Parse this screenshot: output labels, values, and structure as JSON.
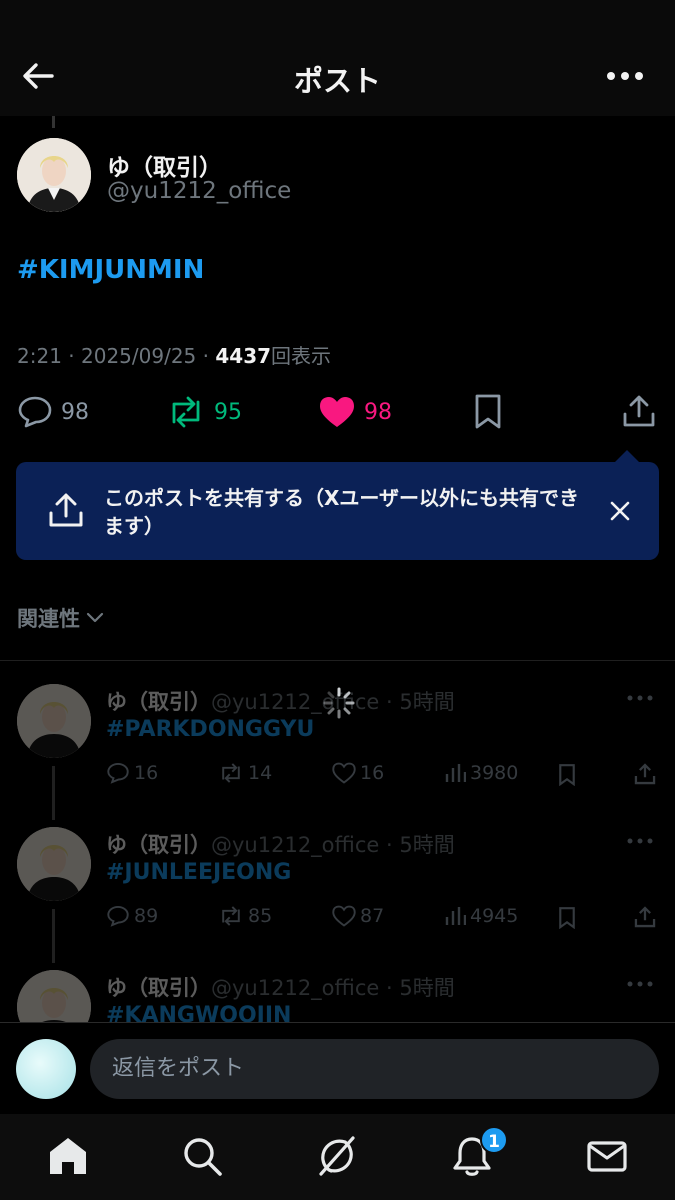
{
  "header": {
    "title": "ポスト"
  },
  "post": {
    "author_name": "ゆ（取引）",
    "author_handle": "@yu1212_office",
    "text": "#KIMJUNMIN",
    "time": "2:21",
    "sep1": " · ",
    "date": "2025/09/25",
    "sep2": " · ",
    "views": "4437",
    "views_label": "回表示",
    "replies": "98",
    "reposts": "95",
    "likes": "98"
  },
  "tooltip": {
    "text": "このポストを共有する（Xユーザー以外にも共有できます）"
  },
  "sort": {
    "label": "関連性"
  },
  "replies": [
    {
      "name": "ゆ（取引）",
      "handle": "@yu1212_office",
      "time_sep": " · ",
      "time": "5時間",
      "tag": "#PARKDONGGYU",
      "replies": "16",
      "reposts": "14",
      "likes": "16",
      "views": "3980"
    },
    {
      "name": "ゆ（取引）",
      "handle": "@yu1212_office",
      "time_sep": " · ",
      "time": "5時間",
      "tag": "#JUNLEEJEONG",
      "replies": "89",
      "reposts": "85",
      "likes": "87",
      "views": "4945"
    },
    {
      "name": "ゆ（取引）",
      "handle": "@yu1212_office",
      "time_sep": " · ",
      "time": "5時間",
      "tag": "#KANGWOOJIN"
    }
  ],
  "reply_box": {
    "placeholder": "返信をポスト"
  },
  "nav": {
    "notifications_badge": "1"
  },
  "colors": {
    "accent": "#1d9bf0",
    "repost": "#00ba7c",
    "like": "#f91880",
    "tooltip_bg": "#0b2156"
  }
}
